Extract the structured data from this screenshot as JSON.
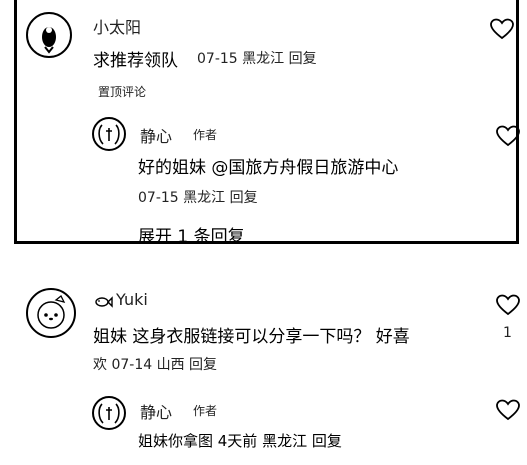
{
  "comment1": {
    "username": "小太阳",
    "text": "求推荐领队",
    "meta": "07-15 黑龙江 回复",
    "pinned_label": "置顶评论",
    "reply": {
      "username": "静心",
      "author_tag": "作者",
      "text": "好的姐妹 @国旅方舟假日旅游中心",
      "meta": "07-15 黑龙江 回复"
    },
    "expand_label": "展开 1 条回复"
  },
  "comment2": {
    "username": "Yuki",
    "text_line1": "姐妹 这身衣服链接可以分享一下吗？ 好喜",
    "text_line2_meta": "欢 07-14 山西 回复",
    "like_count": "1",
    "reply": {
      "username": "静心",
      "author_tag": "作者",
      "text_meta": "姐妹你拿图 4天前 黑龙江 回复"
    }
  },
  "icons": {
    "like": "heart-outline-icon",
    "fish": "fish-icon"
  }
}
